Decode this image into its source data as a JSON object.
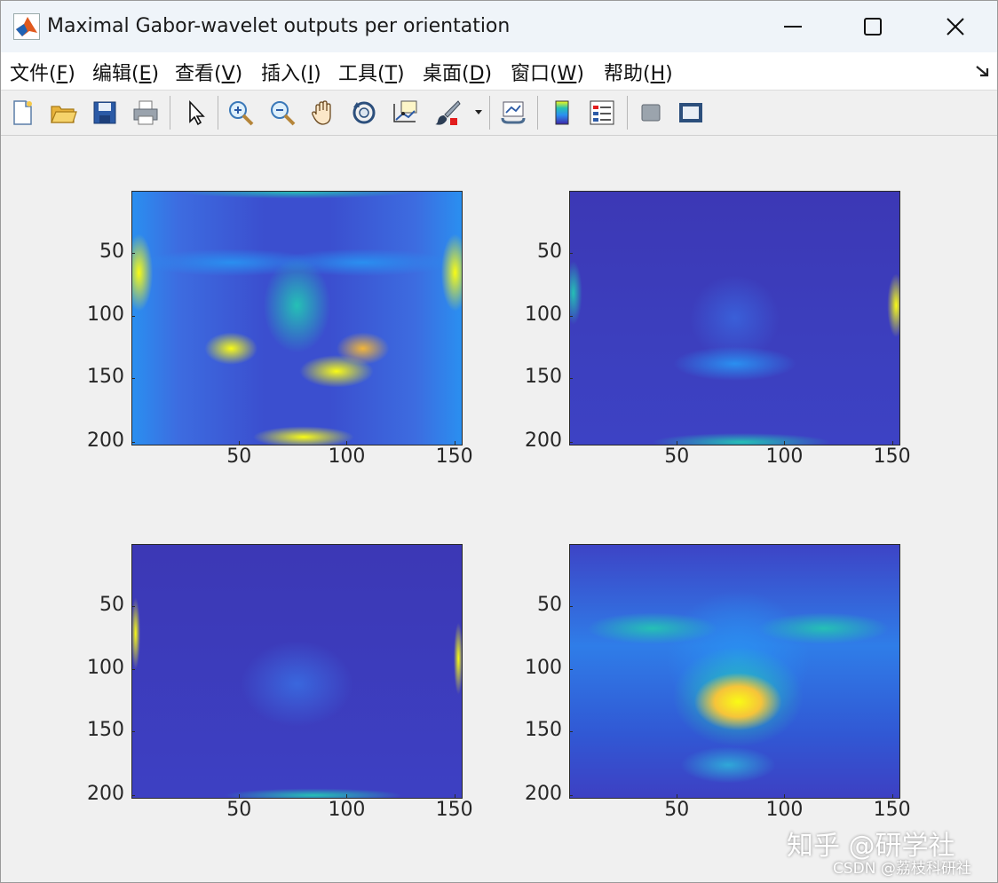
{
  "window": {
    "title": "Maximal Gabor-wavelet outputs per orientation"
  },
  "menubar": {
    "items": [
      {
        "label": "文件(",
        "key": "F",
        "end": ")"
      },
      {
        "label": "编辑(",
        "key": "E",
        "end": ")"
      },
      {
        "label": "查看(",
        "key": "V",
        "end": ")"
      },
      {
        "label": "插入(",
        "key": "I",
        "end": ")"
      },
      {
        "label": "工具(",
        "key": "T",
        "end": ")"
      },
      {
        "label": "桌面(",
        "key": "D",
        "end": ")"
      },
      {
        "label": "窗口(",
        "key": "W",
        "end": ")"
      },
      {
        "label": "帮助(",
        "key": "H",
        "end": ")"
      }
    ],
    "dock_icon": "dock-arrow-icon"
  },
  "toolbar": {
    "icons": [
      "new-figure-icon",
      "open-file-icon",
      "save-icon",
      "print-icon",
      "select-arrow-icon",
      "zoom-in-icon",
      "zoom-out-icon",
      "pan-hand-icon",
      "rotate-3d-icon",
      "data-cursor-icon",
      "brush-icon",
      "brush-dropdown-icon",
      "link-plot-icon",
      "colorbar-icon",
      "legend-icon",
      "hide-plot-tools-icon",
      "show-plot-tools-icon"
    ]
  },
  "axes": [
    {
      "name": "orientation-1",
      "yticks": [
        "50",
        "100",
        "150",
        "200"
      ],
      "xticks": [
        "50",
        "100",
        "150"
      ]
    },
    {
      "name": "orientation-2",
      "yticks": [
        "50",
        "100",
        "150",
        "200"
      ],
      "xticks": [
        "50",
        "100",
        "150"
      ]
    },
    {
      "name": "orientation-3",
      "yticks": [
        "50",
        "100",
        "150",
        "200"
      ],
      "xticks": [
        "50",
        "100",
        "150"
      ]
    },
    {
      "name": "orientation-4",
      "yticks": [
        "50",
        "100",
        "150",
        "200"
      ],
      "xticks": [
        "50",
        "100",
        "150"
      ]
    }
  ],
  "colors": {
    "colormap_low": "#3e26a8",
    "colormap_mid": "#2a8ff0",
    "colormap_teal": "#25c0b5",
    "colormap_high": "#f9fb15"
  },
  "watermark": {
    "line1": "知乎 @研学社",
    "line2": "CSDN @荔枝科研社"
  }
}
